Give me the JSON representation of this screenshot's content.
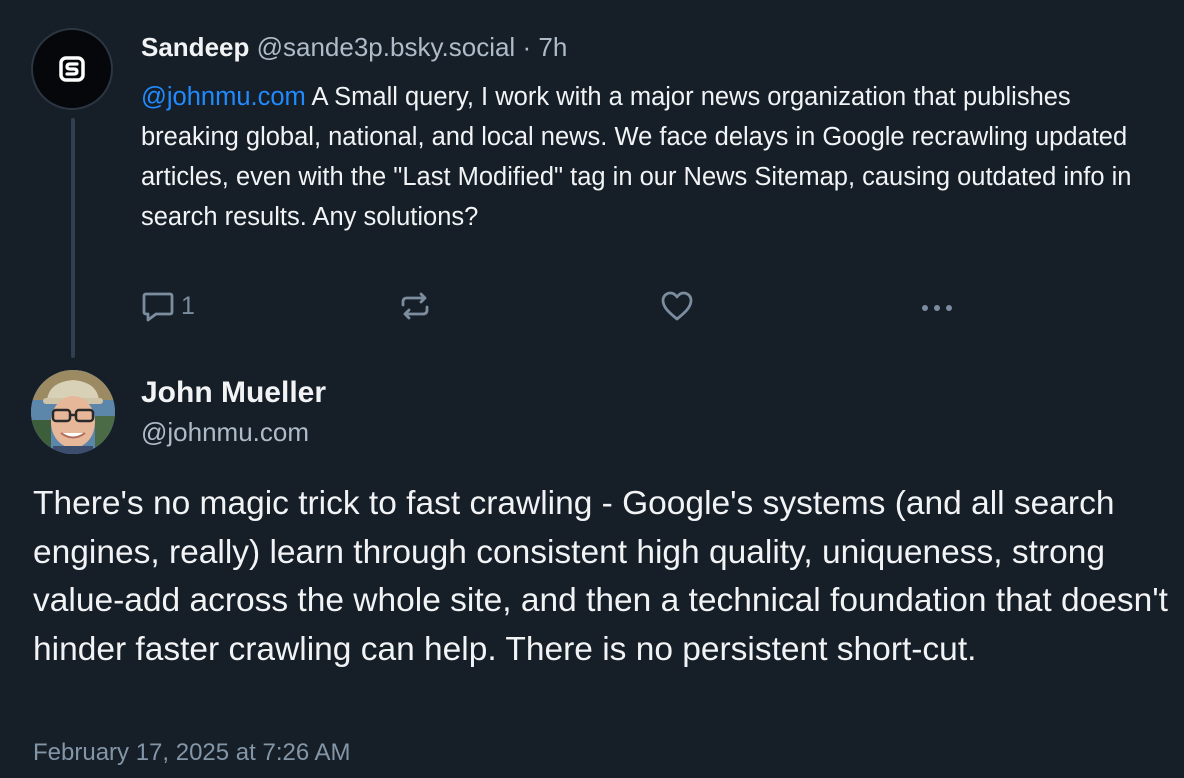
{
  "parent_post": {
    "author_name": "Sandeep",
    "author_handle": "@sande3p.bsky.social",
    "separator": "·",
    "time_ago": "7h",
    "avatar_letter": "S",
    "mention": "@johnmu.com",
    "text": " A Small query, I work with a major news organization that publishes breaking global, national, and local news. We face delays in Google recrawling updated articles, even with the \"Last Modified\" tag in our News Sitemap, causing outdated info in search results. Any solutions?",
    "actions": {
      "reply_icon": "speech-bubble-icon",
      "reply_count": "1",
      "repost_icon": "repost-arrows-icon",
      "like_icon": "heart-icon",
      "more_icon": "ellipsis-icon"
    }
  },
  "reply_post": {
    "author_name": "John Mueller",
    "author_handle": "@johnmu.com",
    "text": "There's no magic trick to fast crawling - Google's systems (and all search engines, really) learn through consistent high quality, uniqueness, strong value-add across the whole site, and then a technical foundation that doesn't hinder faster crawling can help. There is no persistent short-cut.",
    "timestamp": "February 17, 2025 at 7:26 AM"
  },
  "colors": {
    "background": "#161e27",
    "link": "#208bfe",
    "muted_text": "#aebbc9",
    "icon": "#7b8d9f"
  }
}
